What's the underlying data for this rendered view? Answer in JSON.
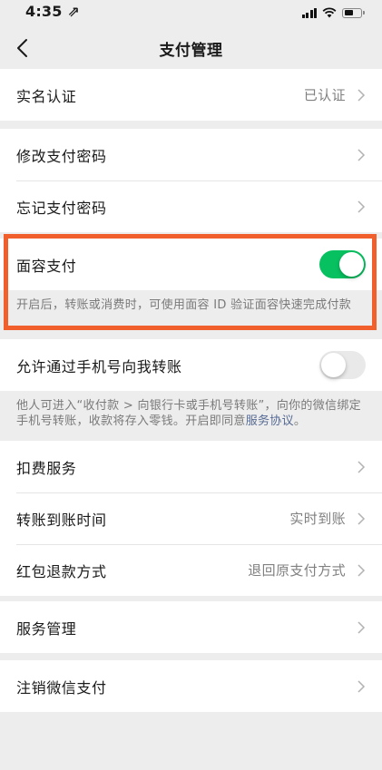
{
  "status_bar": {
    "time": "4:35 ⇗"
  },
  "nav": {
    "title": "支付管理"
  },
  "sections": {
    "realname": {
      "label": "实名认证",
      "value": "已认证"
    },
    "password": {
      "change_label": "修改支付密码",
      "forgot_label": "忘记支付密码"
    },
    "face_pay": {
      "label": "面容支付",
      "enabled": true,
      "description": "开启后，转账或消费时，可使用面容 ID 验证面容快速完成付款"
    },
    "phone_transfer": {
      "label": "允许通过手机号向我转账",
      "enabled": false,
      "description_prefix": "他人可进入“收付款 > 向银行卡或手机号转账”，向你的微信绑定手机号转账，收款将存入零钱。开启即同意",
      "description_link": "服务协议",
      "description_suffix": "。"
    },
    "services": {
      "deduction_label": "扣费服务",
      "arrival_label": "转账到账时间",
      "arrival_value": "实时到账",
      "refund_label": "红包退款方式",
      "refund_value": "退回原支付方式"
    },
    "manage": {
      "label": "服务管理"
    },
    "cancel": {
      "label": "注销微信支付"
    }
  },
  "colors": {
    "toggle_on": "#07c160",
    "highlight_border": "#f05f2c",
    "link": "#576b95"
  }
}
